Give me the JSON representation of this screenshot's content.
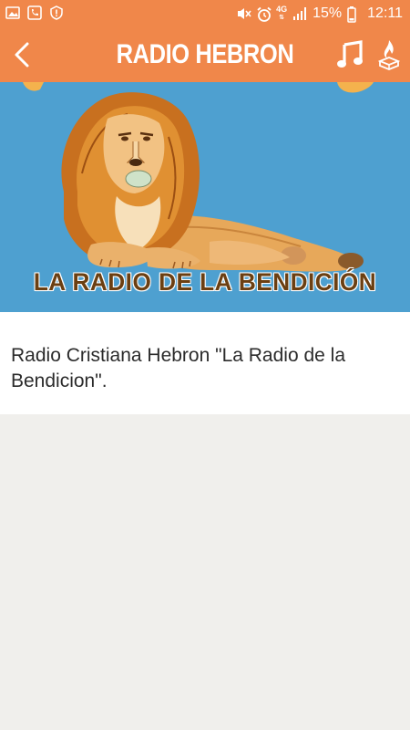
{
  "status_bar": {
    "network": "4G",
    "battery": "15%",
    "time": "12:11"
  },
  "app_bar": {
    "title": "RADIO HEBRON"
  },
  "banner": {
    "caption": "LA RADIO DE LA BENDICIÓN",
    "background_color": "#4ea0d0"
  },
  "description": {
    "text": "Radio Cristiana Hebron \"La Radio de la Bendicion\"."
  },
  "colors": {
    "accent": "#f0874a",
    "banner_text": "#6b3f12"
  },
  "icons": {
    "back": "chevron-left-icon",
    "music": "music-note-icon",
    "bible": "bible-flame-icon"
  }
}
